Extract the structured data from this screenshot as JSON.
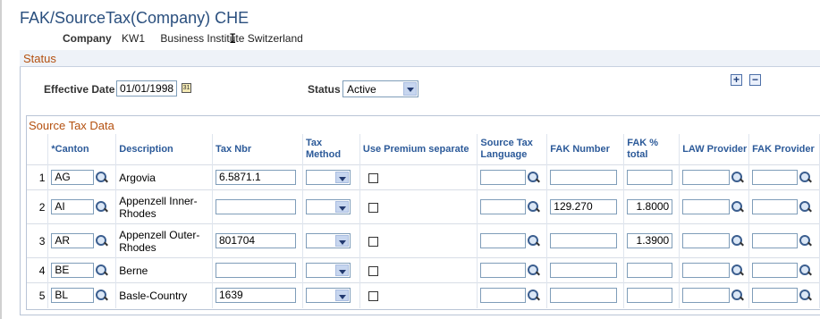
{
  "page": {
    "title": "FAK/SourceTax(Company) CHE"
  },
  "company": {
    "label": "Company",
    "code": "KW1",
    "name": "Business Institute Switzerland"
  },
  "status_section": {
    "title": "Status",
    "effective_date_label": "Effective Date",
    "effective_date": "01/01/1998",
    "status_label": "Status",
    "status_value": "Active"
  },
  "source_tax": {
    "title": "Source Tax Data",
    "columns": {
      "canton": "*Canton",
      "description": "Description",
      "tax_nbr": "Tax Nbr",
      "tax_method": "Tax Method",
      "use_premium": "Use Premium separate",
      "source_tax_language": "Source Tax Language",
      "fak_number": "FAK Number",
      "fak_pct_total": "FAK % total",
      "law_provider": "LAW Provider",
      "fak_provider": "FAK Provider"
    },
    "rows": [
      {
        "num": "1",
        "canton": "AG",
        "description": "Argovia",
        "tax_nbr": "6.5871.1",
        "fak_number": "",
        "fak_pct": ""
      },
      {
        "num": "2",
        "canton": "AI",
        "description": "Appenzell Inner-Rhodes",
        "tax_nbr": "",
        "fak_number": "129.270",
        "fak_pct": "1.8000"
      },
      {
        "num": "3",
        "canton": "AR",
        "description": "Appenzell Outer-Rhodes",
        "tax_nbr": "801704",
        "fak_number": "",
        "fak_pct": "1.3900"
      },
      {
        "num": "4",
        "canton": "BE",
        "description": "Berne",
        "tax_nbr": "",
        "fak_number": "",
        "fak_pct": ""
      },
      {
        "num": "5",
        "canton": "BL",
        "description": "Basle-Country",
        "tax_nbr": "1639",
        "fak_number": "",
        "fak_pct": ""
      }
    ]
  },
  "icons": {
    "add": "plus-icon",
    "remove": "minus-icon",
    "calendar": "calendar-icon",
    "lookup": "magnifier-icon"
  }
}
